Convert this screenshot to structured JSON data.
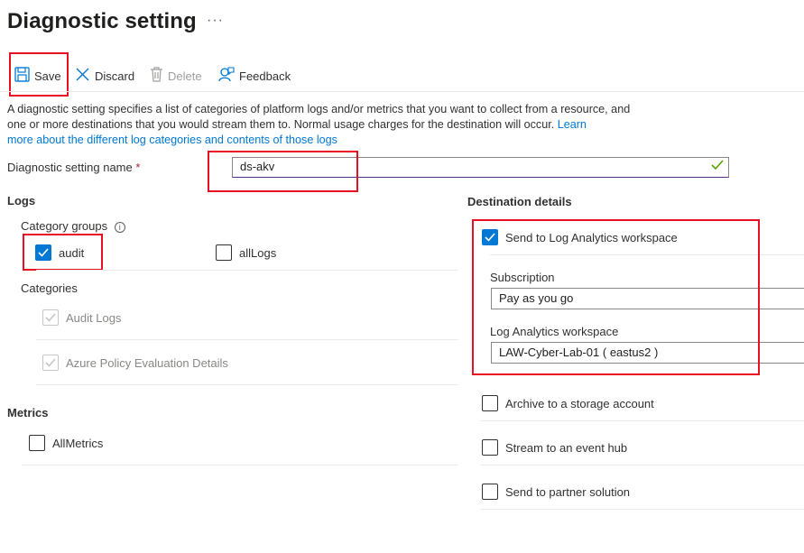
{
  "header": {
    "title": "Diagnostic setting",
    "more": "···"
  },
  "toolbar": {
    "save_label": "Save",
    "discard_label": "Discard",
    "delete_label": "Delete",
    "feedback_label": "Feedback"
  },
  "description": {
    "text": "A diagnostic setting specifies a list of categories of platform logs and/or metrics that you want to collect from a resource, and one or more destinations that you would stream them to. Normal usage charges for the destination will occur. ",
    "link_part1": "Learn",
    "link_part2": "more about the different log categories and contents of those logs"
  },
  "setting_name": {
    "label": "Diagnostic setting name",
    "required_mark": "*",
    "value": "ds-akv"
  },
  "logs": {
    "heading": "Logs",
    "category_groups_label": "Category groups",
    "info": "i",
    "groups": [
      {
        "label": "audit",
        "checked": true
      },
      {
        "label": "allLogs",
        "checked": false
      }
    ],
    "categories_label": "Categories",
    "categories": [
      {
        "label": "Audit Logs",
        "checked": true,
        "disabled": true
      },
      {
        "label": "Azure Policy Evaluation Details",
        "checked": true,
        "disabled": true
      }
    ]
  },
  "metrics": {
    "heading": "Metrics",
    "items": [
      {
        "label": "AllMetrics",
        "checked": false
      }
    ]
  },
  "destination": {
    "heading": "Destination details",
    "log_analytics": {
      "label": "Send to Log Analytics workspace",
      "checked": true
    },
    "subscription_label": "Subscription",
    "subscription_value": "Pay as you go",
    "workspace_label": "Log Analytics workspace",
    "workspace_value": "LAW-Cyber-Lab-01 ( eastus2 )",
    "others": [
      {
        "label": "Archive to a storage account",
        "checked": false
      },
      {
        "label": "Stream to an event hub",
        "checked": false
      },
      {
        "label": "Send to partner solution",
        "checked": false
      }
    ]
  },
  "colors": {
    "accent": "#0078d4",
    "highlight": "#e81123",
    "valid": "#57a300"
  }
}
